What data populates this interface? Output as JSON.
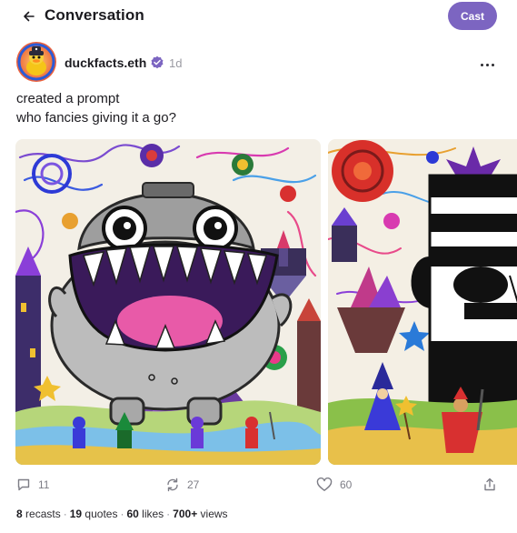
{
  "header": {
    "title": "Conversation",
    "back_icon": "arrow-left-icon",
    "cast_label": "Cast",
    "accent": "#7c65c1"
  },
  "post": {
    "author": "duckfacts.eth",
    "verified_icon": "verified-badge-icon",
    "time": "1d",
    "text_lines": [
      "created a prompt",
      "who fancies giving it a go?"
    ],
    "images": [
      {
        "name": "robot-monster-crayon-drawing"
      },
      {
        "name": "striped-face-crayon-drawing"
      }
    ]
  },
  "actions": {
    "replies": "11",
    "recasts": "27",
    "likes": "60"
  },
  "stats": {
    "recasts_count": "8",
    "recasts_label": "recasts",
    "quotes_count": "19",
    "quotes_label": "quotes",
    "likes_count": "60",
    "likes_label": "likes",
    "views_count": "700+",
    "views_label": "views",
    "separator": "·"
  }
}
